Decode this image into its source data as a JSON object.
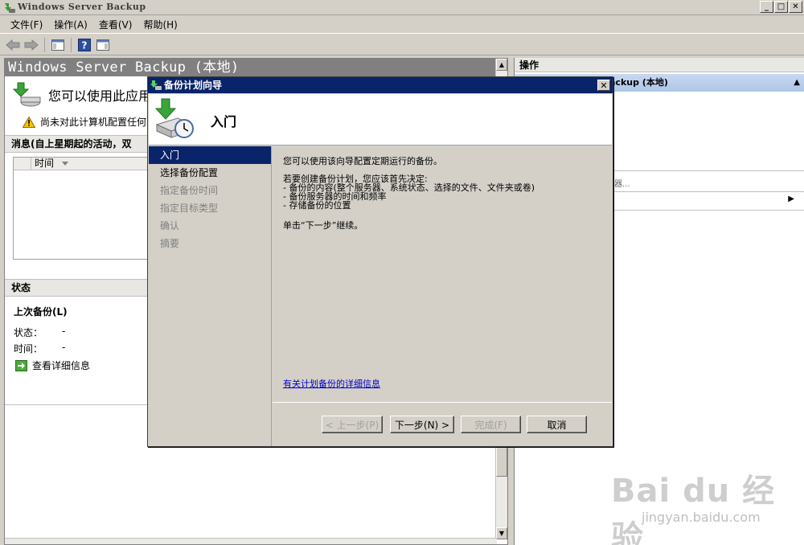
{
  "window": {
    "title": "Windows Server Backup",
    "minimize": "_",
    "maximize": "□",
    "close": "✕"
  },
  "menu": {
    "items": [
      "文件(F)",
      "操作(A)",
      "查看(V)",
      "帮助(H)"
    ]
  },
  "left_pane": {
    "header": "Windows Server Backup (本地)",
    "intro_text": "您可以使用此应用",
    "warning_text": "尚未对此计算机配置任何",
    "messages_header": "消息(自上星期起的活动，双",
    "messages_column": "时间",
    "status_header": "状态",
    "last_backup_label": "上次备份(L)",
    "status_label": "状态：",
    "status_value": "-",
    "time_label": "时间：",
    "time_value": "-",
    "details_link": "查看详细信息"
  },
  "right_pane": {
    "header": "操作",
    "node_label": "ackup (本地)",
    "dots": "器...",
    "arrow": "▶"
  },
  "dialog": {
    "title": "备份计划向导",
    "close": "✕",
    "heading": "入门",
    "steps": [
      {
        "label": "入门",
        "state": "active"
      },
      {
        "label": "选择备份配置",
        "state": "enabled"
      },
      {
        "label": "指定备份时间",
        "state": "disabled"
      },
      {
        "label": "指定目标类型",
        "state": "disabled"
      },
      {
        "label": "确认",
        "state": "disabled"
      },
      {
        "label": "摘要",
        "state": "disabled"
      }
    ],
    "body": {
      "line1": "您可以使用该向导配置定期运行的备份。",
      "line2": "若要创建备份计划，您应该首先决定:",
      "bullet1": "- 备份的内容(整个服务器、系统状态、选择的文件、文件夹或卷)",
      "bullet2": "- 备份服务器的时间和频率",
      "bullet3": "- 存储备份的位置",
      "line3": "单击“下一步”继续。",
      "link": "有关计划备份的详细信息"
    },
    "buttons": {
      "prev": "< 上一步(P)",
      "next": "下一步(N) >",
      "finish": "完成(F)",
      "cancel": "取消"
    }
  },
  "watermark": {
    "brand": "Bai du 经验",
    "url": "jingyan.baidu.com"
  }
}
